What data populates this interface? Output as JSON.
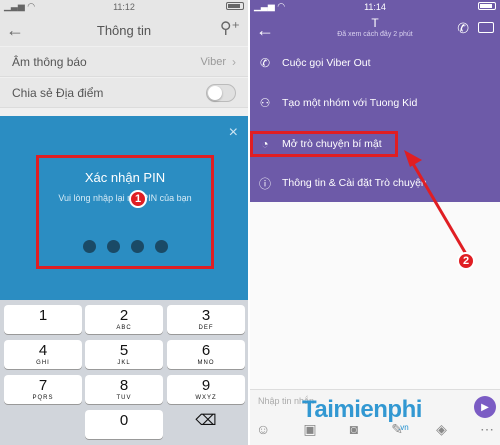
{
  "left": {
    "status": {
      "time": "11:12"
    },
    "header": {
      "title": "Thông tin"
    },
    "rows": [
      {
        "label": "Âm thông báo",
        "value": "Viber"
      },
      {
        "label": "Chia sẻ Địa điểm"
      }
    ],
    "pin": {
      "title": "Xác nhận PIN",
      "subtitle": "Vui lòng nhập lại mã PIN của bạn",
      "dots": 4,
      "close": "×",
      "badge": "1"
    },
    "keypad": [
      {
        "digit": "1",
        "letters": ""
      },
      {
        "digit": "2",
        "letters": "ABC"
      },
      {
        "digit": "3",
        "letters": "DEF"
      },
      {
        "digit": "4",
        "letters": "GHI"
      },
      {
        "digit": "5",
        "letters": "JKL"
      },
      {
        "digit": "6",
        "letters": "MNO"
      },
      {
        "digit": "7",
        "letters": "PQRS"
      },
      {
        "digit": "8",
        "letters": "TUV"
      },
      {
        "digit": "9",
        "letters": "WXYZ"
      },
      {
        "digit": "0",
        "letters": ""
      }
    ],
    "keypad_delete": "⌫"
  },
  "right": {
    "status": {
      "time": "11:14"
    },
    "header": {
      "name": "T",
      "seen": "Đã xem cách đây 2 phút"
    },
    "menu": [
      {
        "icon": "phone-icon",
        "glyph": "✆",
        "label": "Cuộc gọi Viber Out"
      },
      {
        "icon": "group-icon",
        "glyph": "⚇",
        "label": "Tạo một nhóm với Tuong Kid"
      },
      {
        "icon": "secret-chat-icon",
        "glyph": "◔",
        "label": "Mở trò chuyện bí mật"
      },
      {
        "icon": "info-icon",
        "glyph": "ⓘ",
        "label": "Thông tin & Cài đặt Trò chuyện"
      }
    ],
    "badge": "2",
    "composer": {
      "placeholder": "Nhập tin nhắn"
    },
    "watermark": "Taimienphi",
    "watermark_sub": ".vn"
  },
  "colors": {
    "viber_purple": "#6d5aa8",
    "pin_blue": "#2b8dc2",
    "highlight_red": "#e01e23"
  }
}
